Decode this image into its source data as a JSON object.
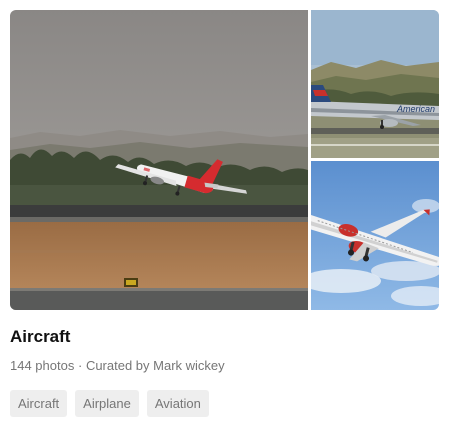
{
  "collection": {
    "title": "Aircraft",
    "photo_count": "144 photos",
    "separator": "·",
    "curated_by": "Curated by Mark wickey",
    "tags": [
      "Aircraft",
      "Airplane",
      "Aviation"
    ]
  },
  "photos": {
    "main_alt": "Red and white airliner taking off from runway",
    "top_right_alt": "American airliner on runway",
    "bottom_right_alt": "Red and white airliner in blue sky",
    "top_right_livery_text": "American"
  },
  "colors": {
    "title": "#111111",
    "meta": "#767676",
    "tag_bg": "#eeeeee",
    "tag_text": "#767676"
  }
}
